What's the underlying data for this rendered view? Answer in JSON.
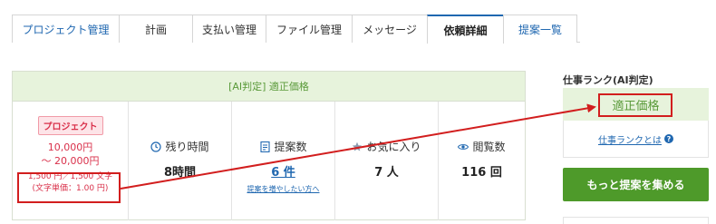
{
  "tabs": [
    {
      "label": "プロジェクト管理",
      "active": false
    },
    {
      "label": "計画",
      "active": false
    },
    {
      "label": "支払い管理",
      "active": false
    },
    {
      "label": "ファイル管理",
      "active": false
    },
    {
      "label": "メッセージ",
      "active": false
    },
    {
      "label": "依頼詳細",
      "active": true
    },
    {
      "label": "提案一覧",
      "active": false
    }
  ],
  "card": {
    "header": "[AI判定] 適正価格",
    "project": {
      "badge": "プロジェクト",
      "price_min": "10,000円",
      "price_max": "～ 20,000円",
      "unit_line1": "1,500 円／1,500 文字",
      "unit_line2": "(文字単価：1.00 円)"
    },
    "remaining": {
      "label": "残り時間",
      "value": "8時間"
    },
    "proposals": {
      "label": "提案数",
      "value": "6 件",
      "link": "提案を増やしたい方へ"
    },
    "favorites": {
      "label": "お気に入り",
      "value": "7 人"
    },
    "views": {
      "label": "閲覧数",
      "value": "116 回"
    }
  },
  "sidebar": {
    "title": "仕事ランク(AI判定)",
    "rank": "適正価格",
    "rank_link": "仕事ランクとは",
    "cta": "もっと提案を集める"
  },
  "colors": {
    "accent_blue": "#1f67b0",
    "green_bg": "#e7f3dc",
    "green_text": "#5a9a3a",
    "cta_green": "#4e9a2a",
    "price_red": "#d9304a",
    "annotation_red": "#d21e1e"
  }
}
